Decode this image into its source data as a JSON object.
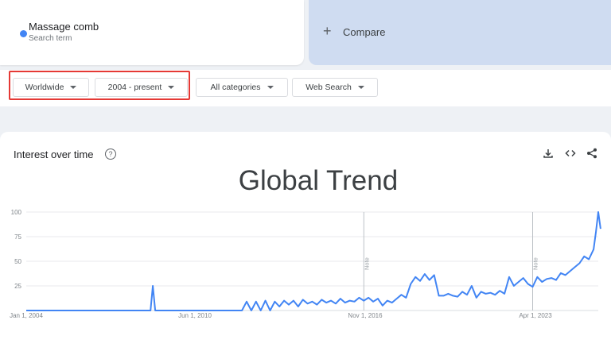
{
  "search_term": {
    "name": "Massage comb",
    "subtitle": "Search term",
    "color": "#4285f4"
  },
  "compare": {
    "label": "Compare"
  },
  "filters": {
    "region": "Worldwide",
    "time_range": "2004 - present",
    "category": "All categories",
    "search_type": "Web Search"
  },
  "chart_header": {
    "title": "Interest over time"
  },
  "overlay_title": "Global Trend",
  "chart_data": {
    "type": "line",
    "title": "Interest over time",
    "ylim": [
      0,
      100
    ],
    "y_ticks": [
      "100",
      "75",
      "50",
      "25"
    ],
    "x_tick_labels": [
      "Jan 1, 2004",
      "Jun 1, 2010",
      "Nov 1, 2016",
      "Apr 1, 2023"
    ],
    "x_range": [
      "2004-01",
      "2024-05"
    ],
    "notes": [
      {
        "date": "2016-01",
        "label": "Note"
      },
      {
        "date": "2022-01",
        "label": "Note"
      }
    ],
    "grid": true,
    "series": [
      {
        "color": "#4285f4",
        "points": [
          [
            "2004-01",
            0
          ],
          [
            "2006-06",
            0
          ],
          [
            "2008-06",
            0
          ],
          [
            "2008-07",
            25
          ],
          [
            "2008-08",
            0
          ],
          [
            "2011-09",
            0
          ],
          [
            "2011-11",
            9
          ],
          [
            "2012-01",
            0
          ],
          [
            "2012-03",
            9
          ],
          [
            "2012-05",
            0
          ],
          [
            "2012-07",
            10
          ],
          [
            "2012-09",
            0
          ],
          [
            "2012-11",
            9
          ],
          [
            "2013-01",
            4
          ],
          [
            "2013-03",
            10
          ],
          [
            "2013-05",
            6
          ],
          [
            "2013-07",
            10
          ],
          [
            "2013-09",
            4
          ],
          [
            "2013-11",
            11
          ],
          [
            "2014-01",
            7
          ],
          [
            "2014-03",
            9
          ],
          [
            "2014-05",
            6
          ],
          [
            "2014-07",
            11
          ],
          [
            "2014-09",
            8
          ],
          [
            "2014-11",
            10
          ],
          [
            "2015-01",
            7
          ],
          [
            "2015-03",
            12
          ],
          [
            "2015-05",
            8
          ],
          [
            "2015-07",
            10
          ],
          [
            "2015-09",
            9
          ],
          [
            "2015-11",
            13
          ],
          [
            "2016-01",
            10
          ],
          [
            "2016-03",
            13
          ],
          [
            "2016-05",
            9
          ],
          [
            "2016-07",
            12
          ],
          [
            "2016-09",
            5
          ],
          [
            "2016-11",
            10
          ],
          [
            "2017-01",
            8
          ],
          [
            "2017-03",
            12
          ],
          [
            "2017-05",
            16
          ],
          [
            "2017-07",
            13
          ],
          [
            "2017-09",
            27
          ],
          [
            "2017-11",
            34
          ],
          [
            "2018-01",
            30
          ],
          [
            "2018-03",
            37
          ],
          [
            "2018-05",
            31
          ],
          [
            "2018-07",
            36
          ],
          [
            "2018-09",
            15
          ],
          [
            "2018-11",
            15
          ],
          [
            "2019-01",
            17
          ],
          [
            "2019-03",
            15
          ],
          [
            "2019-05",
            14
          ],
          [
            "2019-07",
            19
          ],
          [
            "2019-09",
            16
          ],
          [
            "2019-11",
            25
          ],
          [
            "2020-01",
            13
          ],
          [
            "2020-03",
            19
          ],
          [
            "2020-05",
            17
          ],
          [
            "2020-07",
            18
          ],
          [
            "2020-09",
            16
          ],
          [
            "2020-11",
            20
          ],
          [
            "2021-01",
            17
          ],
          [
            "2021-03",
            34
          ],
          [
            "2021-05",
            25
          ],
          [
            "2021-07",
            29
          ],
          [
            "2021-09",
            33
          ],
          [
            "2021-11",
            27
          ],
          [
            "2022-01",
            24
          ],
          [
            "2022-03",
            34
          ],
          [
            "2022-05",
            29
          ],
          [
            "2022-07",
            32
          ],
          [
            "2022-09",
            33
          ],
          [
            "2022-11",
            31
          ],
          [
            "2023-01",
            38
          ],
          [
            "2023-03",
            36
          ],
          [
            "2023-05",
            40
          ],
          [
            "2023-07",
            44
          ],
          [
            "2023-09",
            48
          ],
          [
            "2023-11",
            55
          ],
          [
            "2024-01",
            52
          ],
          [
            "2024-03",
            62
          ],
          [
            "2024-04",
            80
          ],
          [
            "2024-05",
            100
          ],
          [
            "2024-06",
            83
          ]
        ]
      }
    ]
  }
}
